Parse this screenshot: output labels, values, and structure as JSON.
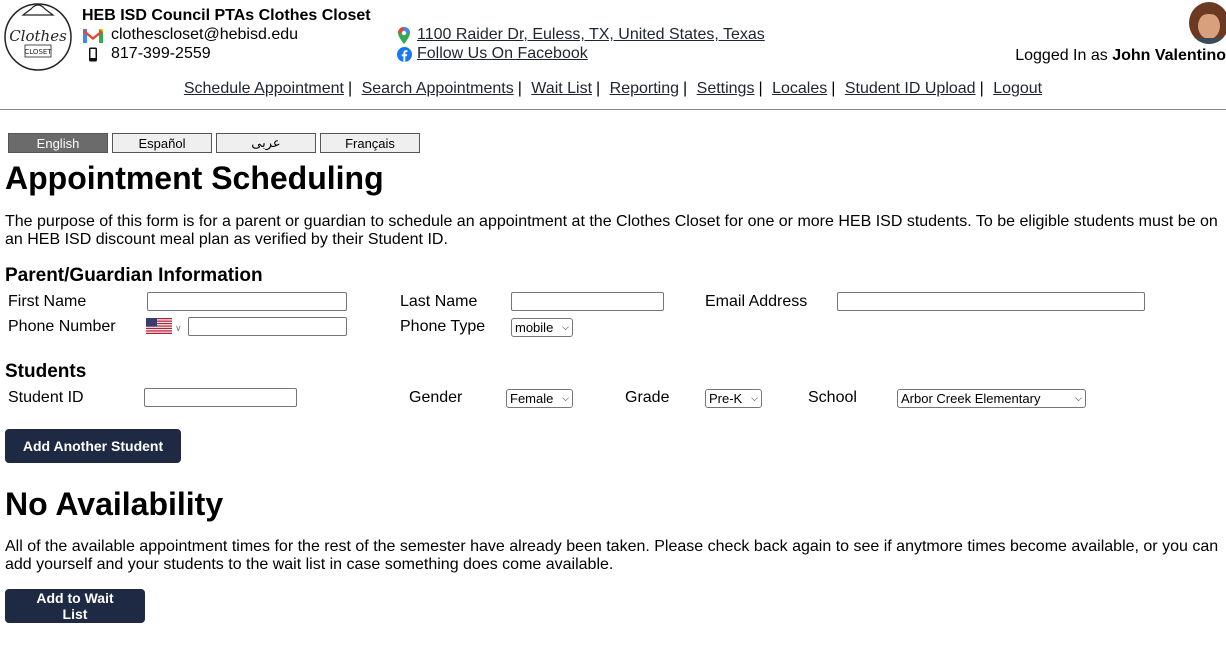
{
  "header": {
    "org_name": "HEB ISD Council PTAs Clothes Closet",
    "email": "clothescloset@hebisd.edu",
    "phone": "817-399-2559",
    "address": "1100 Raider Dr, Euless, TX, United States, Texas",
    "facebook": "Follow Us On Facebook",
    "logged_in_prefix": "Logged In as",
    "user_name": "John Valentino",
    "logo_text": "Clothes",
    "logo_sub": "CLOSET"
  },
  "nav": [
    "Schedule Appointment",
    "Search Appointments",
    "Wait List",
    "Reporting",
    "Settings",
    "Locales",
    "Student ID Upload",
    "Logout"
  ],
  "languages": [
    {
      "label": "English",
      "active": true
    },
    {
      "label": "Español",
      "active": false
    },
    {
      "label": "عربى",
      "active": false
    },
    {
      "label": "Français",
      "active": false
    }
  ],
  "scheduling": {
    "title": "Appointment Scheduling",
    "intro": "The purpose of this form is for a parent or guardian to schedule an appointment at the Clothes Closet for one or more HEB ISD students. To be eligible students must be on an HEB ISD discount meal plan as verified by their Student ID."
  },
  "guardian": {
    "heading": "Parent/Guardian Information",
    "first_name_label": "First Name",
    "last_name_label": "Last Name",
    "email_label": "Email Address",
    "phone_label": "Phone Number",
    "phone_type_label": "Phone Type",
    "phone_type_value": "mobile",
    "first_name_value": "",
    "last_name_value": "",
    "email_value": "",
    "phone_value": ""
  },
  "students": {
    "heading": "Students",
    "student_id_label": "Student ID",
    "gender_label": "Gender",
    "gender_value": "Female",
    "grade_label": "Grade",
    "grade_value": "Pre-K",
    "school_label": "School",
    "school_value": "Arbor Creek Elementary",
    "add_button": "Add Another Student"
  },
  "availability": {
    "title": "No Availability",
    "message": "All of the available appointment times for the rest of the semester have already been taken. Please check back again to see if anytmore times become available, or you can add yourself and your students to the wait list in case something does come available.",
    "wait_list_button": "Add to Wait List"
  },
  "colors": {
    "primary_button": "#1e2a44",
    "active_language": "#6b6b6b"
  }
}
